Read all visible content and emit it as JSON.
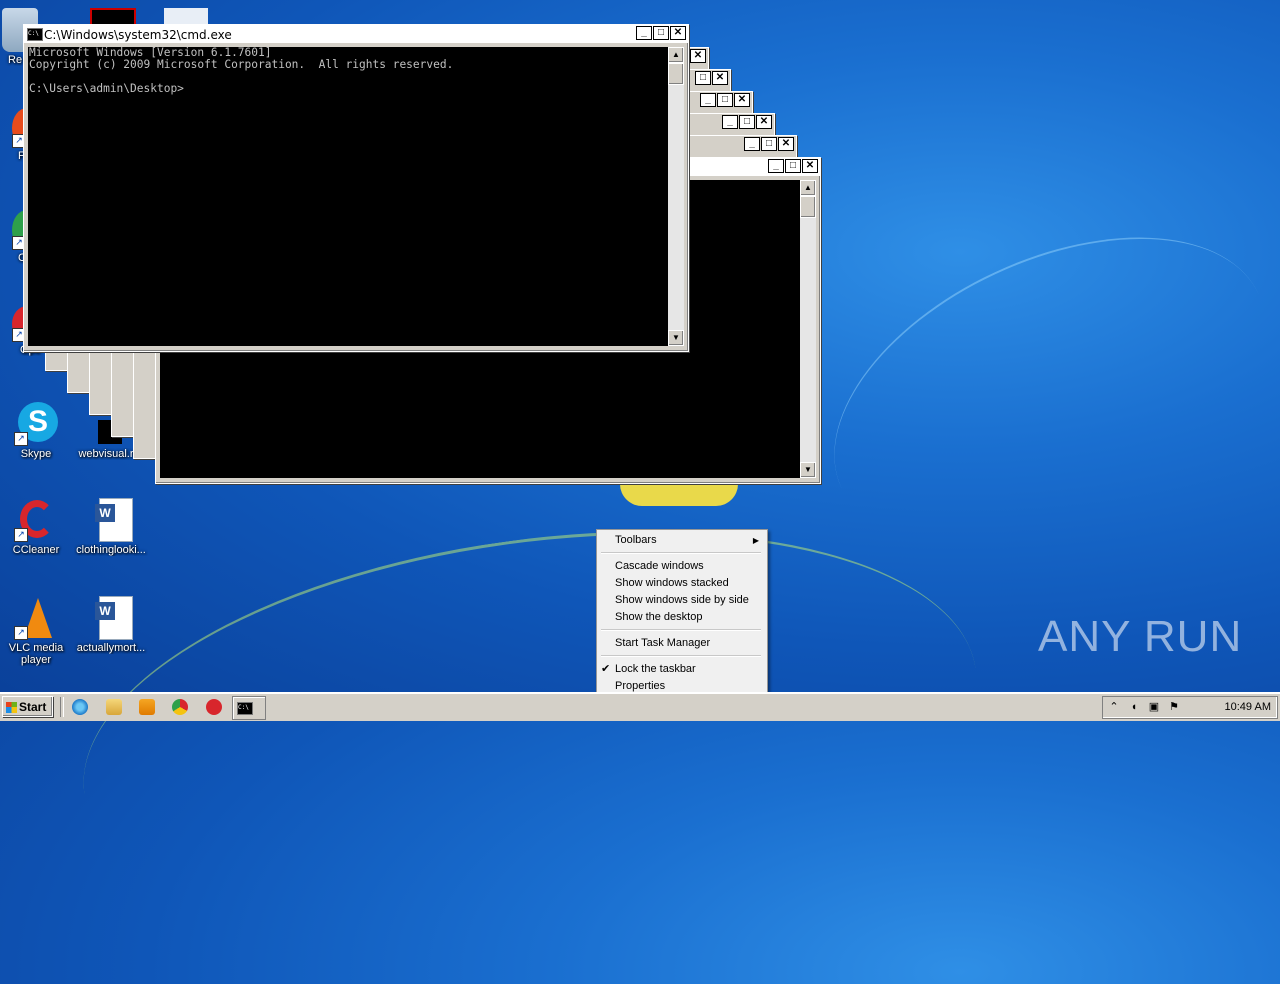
{
  "desktop": {
    "icons": [
      {
        "label": "Re",
        "name": "recycle-bin-icon"
      },
      {
        "label": "F",
        "name": "firefox-icon"
      },
      {
        "label": "C",
        "name": "chrome-icon"
      },
      {
        "label": "Ope",
        "name": "opera-icon"
      },
      {
        "label": "Skype",
        "name": "skype-icon"
      },
      {
        "label": "webvisual.r",
        "name": "webvisual-file-icon"
      },
      {
        "label": "CCleaner",
        "name": "ccleaner-icon"
      },
      {
        "label": "clothinglooki...",
        "name": "word-document-icon"
      },
      {
        "label": "VLC media player",
        "name": "vlc-icon"
      },
      {
        "label": "actuallymort...",
        "name": "word-document-icon"
      }
    ]
  },
  "cmd_window": {
    "title": "C:\\Windows\\system32\\cmd.exe",
    "lines": [
      "Microsoft Windows [Version 6.1.7601]",
      "Copyright (c) 2009 Microsoft Corporation.  All rights reserved.",
      "",
      "C:\\Users\\admin\\Desktop>"
    ]
  },
  "context_menu": {
    "items": [
      {
        "label": "Toolbars",
        "submenu": true
      },
      {
        "label": "Cascade windows"
      },
      {
        "label": "Show windows stacked"
      },
      {
        "label": "Show windows side by side"
      },
      {
        "label": "Show the desktop"
      },
      {
        "label": "Start Task Manager"
      },
      {
        "label": "Lock the taskbar",
        "checked": true
      },
      {
        "label": "Properties"
      }
    ]
  },
  "taskbar": {
    "start_label": "Start",
    "clock": "10:49 AM",
    "quicklaunch": [
      "ie-icon",
      "explorer-icon",
      "media-player-icon",
      "chrome-icon",
      "opera-icon",
      "cmd-icon"
    ],
    "accent": "#d4d0c8"
  },
  "watermark": "ANY RUN"
}
